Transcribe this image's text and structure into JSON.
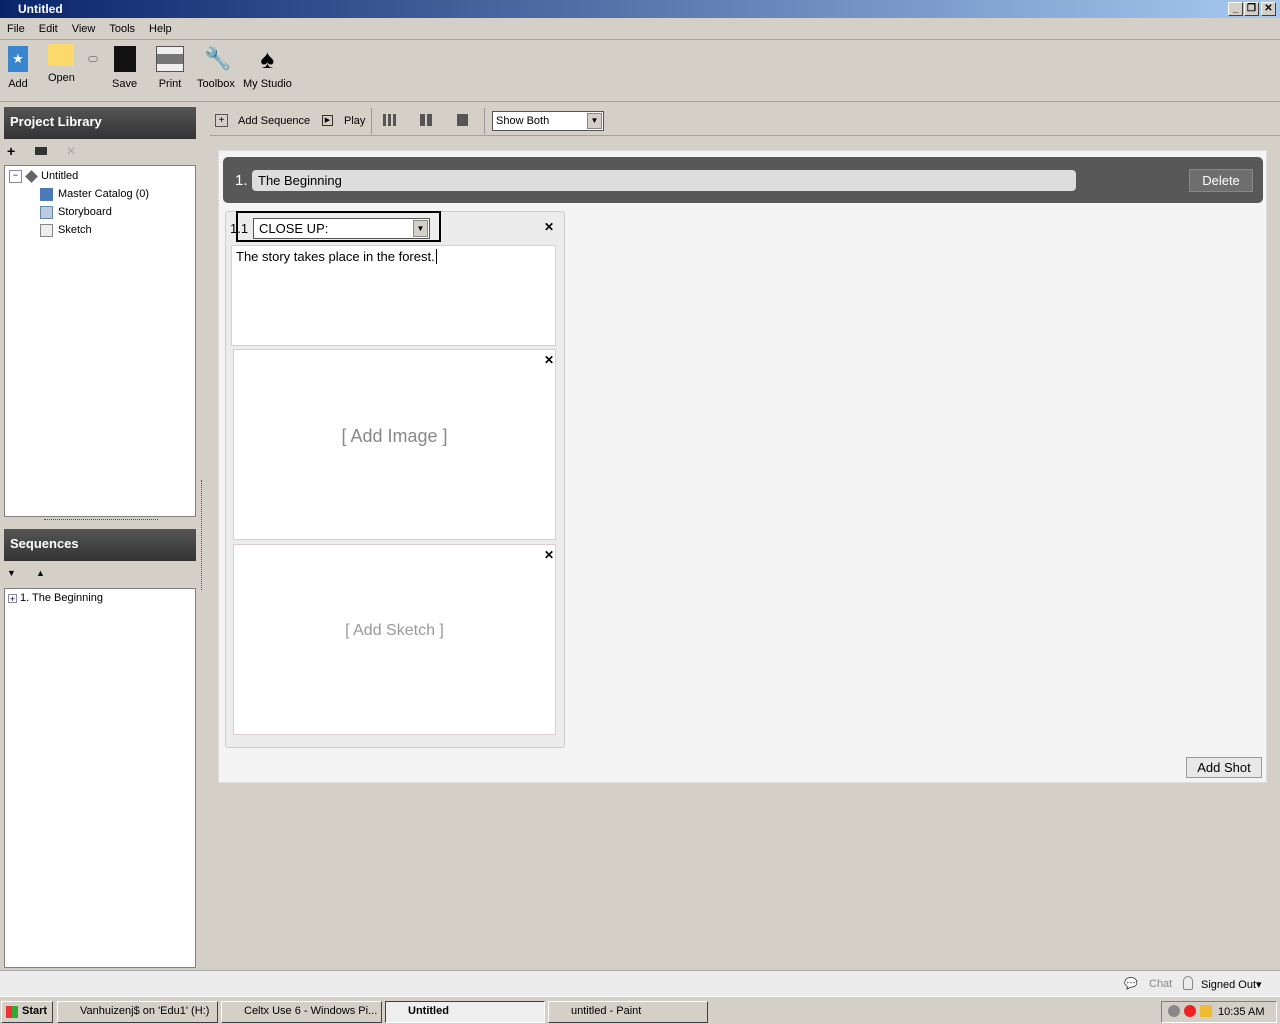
{
  "window": {
    "title": "Untitled"
  },
  "menu": [
    "File",
    "Edit",
    "View",
    "Tools",
    "Help"
  ],
  "toolbar": {
    "add": "Add",
    "open": "Open",
    "save": "Save",
    "print": "Print",
    "toolbox": "Toolbox",
    "my_studio": "My Studio"
  },
  "project_library": {
    "title": "Project Library",
    "tree": {
      "root": "Untitled",
      "items": [
        "Master Catalog (0)",
        "Storyboard",
        "Sketch"
      ]
    }
  },
  "sequences": {
    "title": "Sequences",
    "items": [
      "1. The Beginning"
    ]
  },
  "storyboard_toolbar": {
    "add_sequence": "Add Sequence",
    "play": "Play",
    "view_select": "Show Both"
  },
  "sequence": {
    "number": "1.",
    "title": "The Beginning",
    "delete": "Delete"
  },
  "shot": {
    "number": "1.1",
    "type": "CLOSE UP:",
    "text": "The story takes place in the forest.",
    "add_image": "[ Add Image ]",
    "add_sketch": "[ Add Sketch ]"
  },
  "add_shot": "Add Shot",
  "statusbar": {
    "chat": "Chat",
    "signed_out": "Signed Out"
  },
  "taskbar": {
    "start": "Start",
    "tasks": [
      "Vanhuizenj$ on 'Edu1' (H:)",
      "Celtx Use 6 - Windows Pi...",
      "Untitled",
      "untitled - Paint"
    ],
    "clock": "10:35 AM"
  }
}
